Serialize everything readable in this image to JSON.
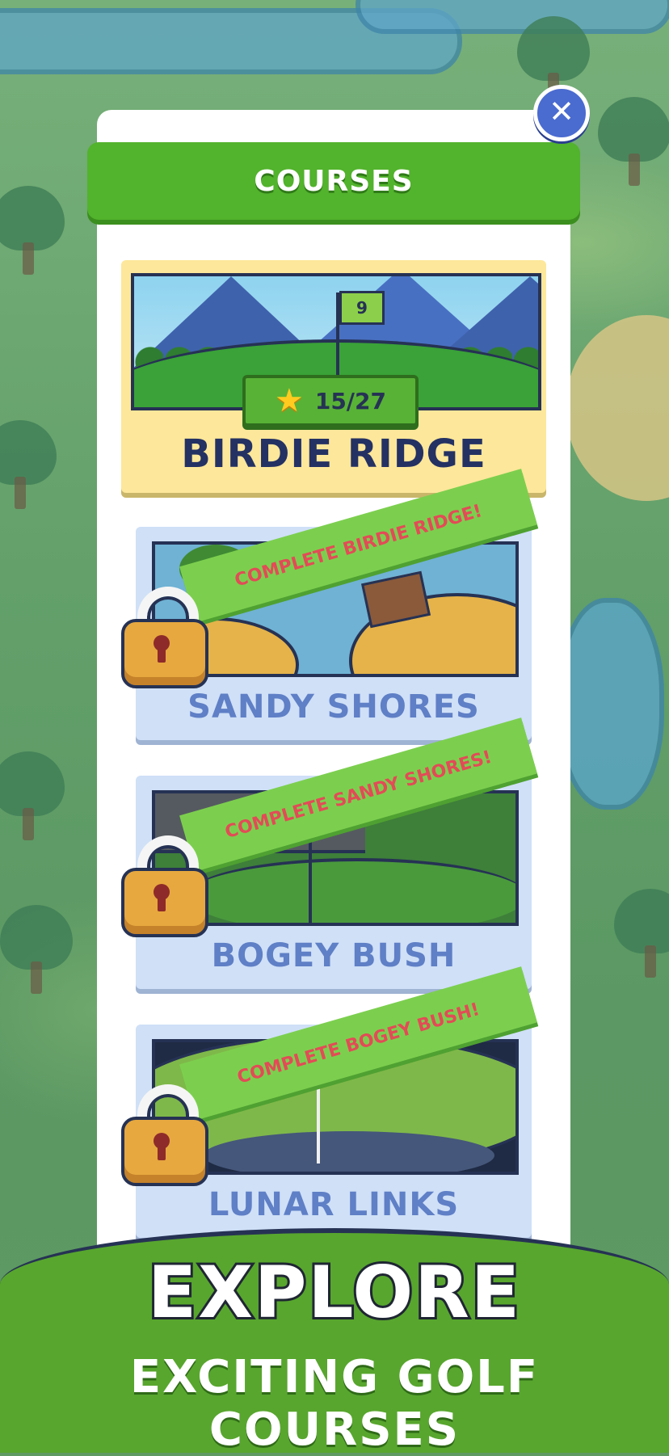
{
  "header": {
    "title": "COURSES"
  },
  "close": {
    "icon": "close-icon",
    "symbol": "✕"
  },
  "courses": [
    {
      "name": "BIRDIE RIDGE",
      "state": "unlocked",
      "flag_number": "9",
      "stars": "15/27"
    },
    {
      "name": "SANDY SHORES",
      "state": "locked",
      "unlock_text": "COMPLETE BIRDIE RIDGE!"
    },
    {
      "name": "BOGEY BUSH",
      "state": "locked",
      "unlock_text": "COMPLETE SANDY SHORES!"
    },
    {
      "name": "LUNAR LINKS",
      "state": "locked",
      "unlock_text": "COMPLETE BOGEY BUSH!"
    }
  ],
  "promo": {
    "line1": "EXPLORE",
    "line2": "EXCITING GOLF COURSES"
  },
  "colors": {
    "accent_green": "#52b32c",
    "close_blue": "#4a6bd0",
    "lock_text_red": "#e34b57",
    "title_navy": "#243163"
  }
}
